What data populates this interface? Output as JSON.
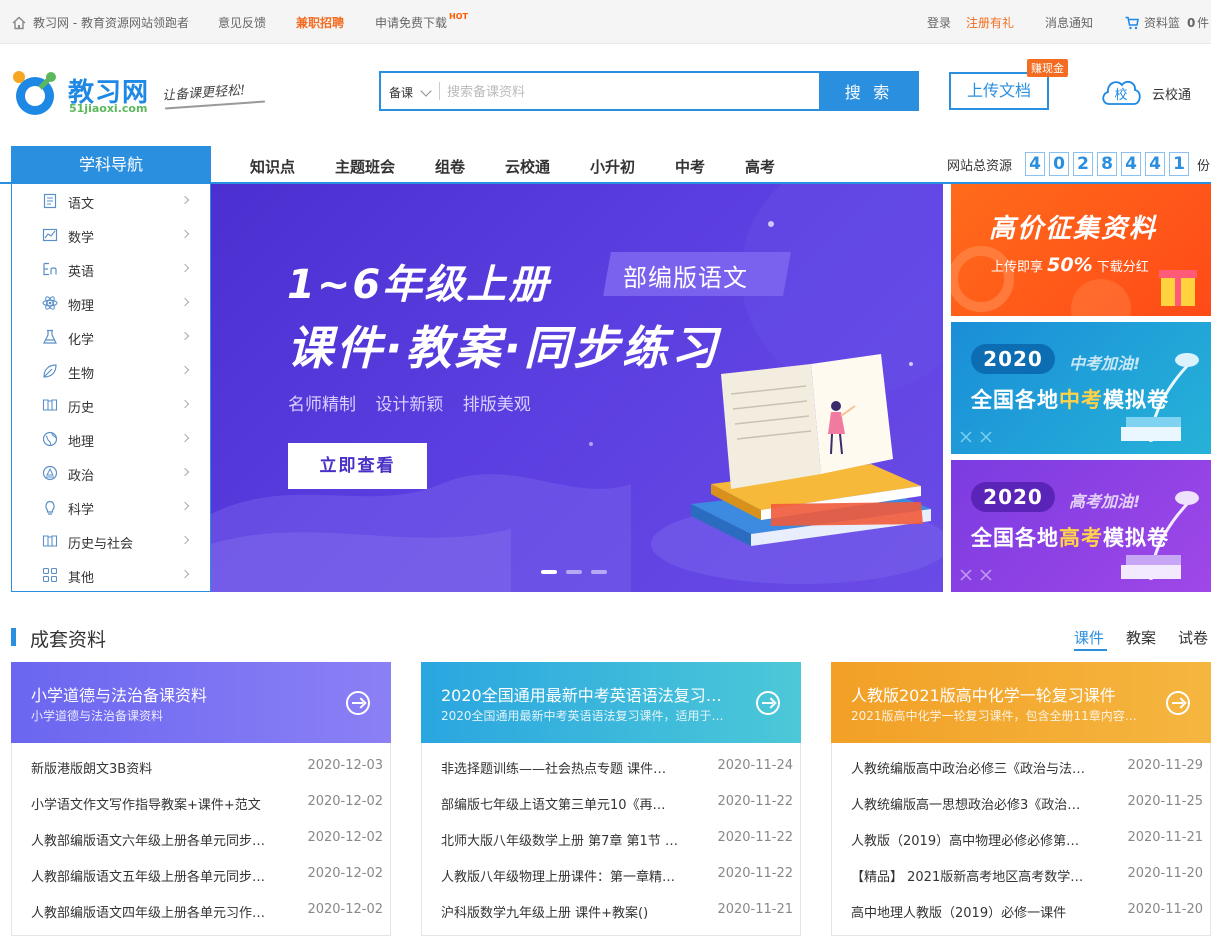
{
  "topbar": {
    "site_label": "教习网 - 教育资源网站领跑者",
    "feedback": "意见反馈",
    "recruit": "兼职招聘",
    "free_download": "申请免费下载",
    "hot_badge": "HOT",
    "login": "登录",
    "register": "注册有礼",
    "notify": "消息通知",
    "basket_label": "资料篮",
    "basket_count": "0",
    "basket_unit": "件"
  },
  "header": {
    "logo_text": "教习网",
    "logo_domain": "51jiaoxi.com",
    "slogan": "让备课更轻松!",
    "search_select": "备课",
    "search_placeholder": "搜索备课资料",
    "search_button": "搜 索",
    "upload_button": "上传文档",
    "earn_badge": "赚现金",
    "cloud_glyph": "校",
    "cloud_label": "云校通"
  },
  "nav": {
    "subject_head": "学科导航",
    "items": [
      "知识点",
      "主题班会",
      "组卷",
      "云校通",
      "小升初",
      "中考",
      "高考"
    ],
    "stat_label": "网站总资源",
    "digits": [
      "4",
      "0",
      "2",
      "8",
      "4",
      "4",
      "1"
    ],
    "stat_unit": "份"
  },
  "subjects": [
    {
      "label": "语文",
      "icon": "book-icon"
    },
    {
      "label": "数学",
      "icon": "chart-icon"
    },
    {
      "label": "英语",
      "icon": "en-icon"
    },
    {
      "label": "物理",
      "icon": "atom-icon"
    },
    {
      "label": "化学",
      "icon": "flask-icon"
    },
    {
      "label": "生物",
      "icon": "leaf-icon"
    },
    {
      "label": "历史",
      "icon": "scroll-icon"
    },
    {
      "label": "地理",
      "icon": "globe-icon"
    },
    {
      "label": "政治",
      "icon": "emblem-icon"
    },
    {
      "label": "科学",
      "icon": "bulb-icon"
    },
    {
      "label": "历史与社会",
      "icon": "scroll-icon"
    },
    {
      "label": "其他",
      "icon": "grid-icon"
    }
  ],
  "banner": {
    "title1": "1~6年级上册",
    "tag": "部编版语文",
    "title2": "课件·教案·同步练习",
    "subtitle": "名师精制 设计新颖 排版美观",
    "button": "立即查看",
    "active_slide": 1
  },
  "ads": {
    "ad1_title": "高价征集资料",
    "ad1_sub_prefix": "上传即享",
    "ad1_sub_percent": "50%",
    "ad1_sub_suffix": "下载分红",
    "ad2_year": "2020",
    "ad2_cheer": "中考加油!",
    "ad2_main_a": "全国各地",
    "ad2_main_hl": "中考",
    "ad2_main_b": "模拟卷",
    "ad3_year": "2020",
    "ad3_cheer": "高考加油!",
    "ad3_main_a": "全国各地",
    "ad3_main_hl": "高考",
    "ad3_main_b": "模拟卷"
  },
  "section": {
    "title": "成套资料",
    "tabs": [
      "课件",
      "教案",
      "试卷"
    ]
  },
  "cards": [
    {
      "title": "小学道德与法治备课资料",
      "subtitle": "小学道德与法治备课资料",
      "rows": [
        {
          "title": "新版港版朗文3B资料",
          "date": "2020-12-03"
        },
        {
          "title": "小学语文作文写作指导教案+课件+范文",
          "date": "2020-12-02"
        },
        {
          "title": "人教部编版语文六年级上册各单元同步…",
          "date": "2020-12-02"
        },
        {
          "title": "人教部编版语文五年级上册各单元同步…",
          "date": "2020-12-02"
        },
        {
          "title": "人教部编版语文四年级上册各单元习作…",
          "date": "2020-12-02"
        }
      ]
    },
    {
      "title": "2020全国通用最新中考英语语法复习…",
      "subtitle": "2020全国通用最新中考英语语法复习课件，适用于…",
      "rows": [
        {
          "title": "非选择题训练——社会热点专题 课件…",
          "date": "2020-11-24"
        },
        {
          "title": "部编版七年级上语文第三单元10《再…",
          "date": "2020-11-22"
        },
        {
          "title": "北师大版八年级数学上册 第7章 第1节 …",
          "date": "2020-11-22"
        },
        {
          "title": "人教版八年级物理上册课件：第一章精…",
          "date": "2020-11-22"
        },
        {
          "title": "沪科版数学九年级上册 课件+教案()",
          "date": "2020-11-21"
        }
      ]
    },
    {
      "title": "人教版2021版高中化学一轮复习课件",
      "subtitle": "2021版高中化学一轮复习课件，包含全册11章内容…",
      "rows": [
        {
          "title": "人教统编版高中政治必修三《政治与法…",
          "date": "2020-11-29"
        },
        {
          "title": "人教统编版高一思想政治必修3《政治…",
          "date": "2020-11-25"
        },
        {
          "title": "人教版（2019）高中物理必修必修第…",
          "date": "2020-11-21"
        },
        {
          "title": "【精品】 2021版新高考地区高考数学…",
          "date": "2020-11-20"
        },
        {
          "title": "高中地理人教版（2019）必修一课件",
          "date": "2020-11-20"
        }
      ]
    }
  ],
  "colors": {
    "brand": "#2b8fe0",
    "accent": "#f36c21",
    "banner": "#5b3ee0"
  }
}
